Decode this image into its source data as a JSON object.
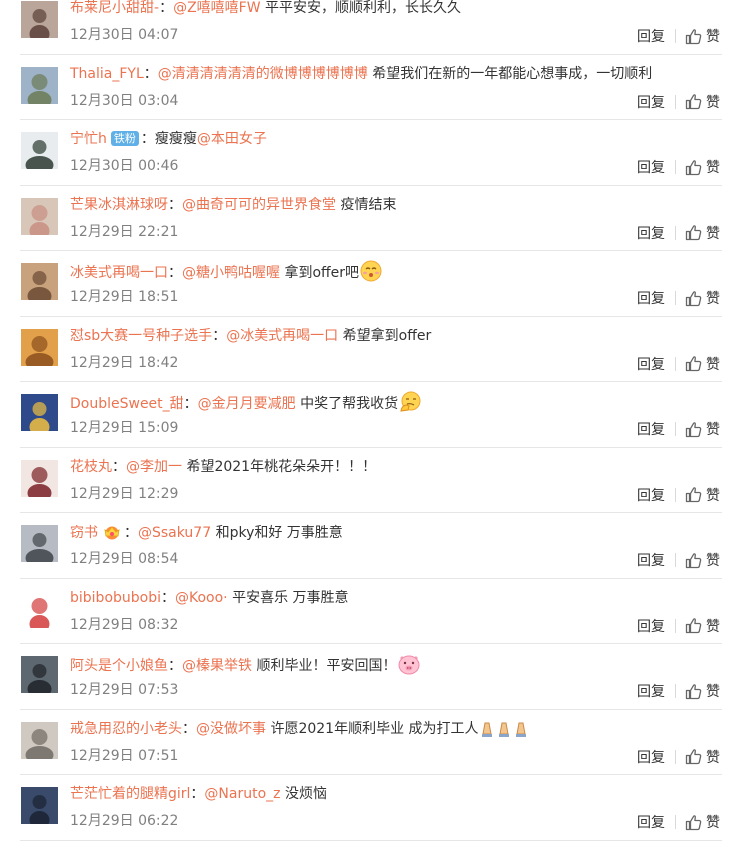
{
  "comments": [
    {
      "user": "布莱尼小甜甜-",
      "colon": "：",
      "mention": "@Z嘻嘻嘻FW",
      "text": " 平平安安，顺顺利利，长长久久",
      "time": "12月30日 04:07",
      "avatar_colors": [
        "#b9a59a",
        "#5a4038"
      ]
    },
    {
      "user": "Thalia_FYL",
      "colon": "：",
      "mention": "@清清清清清清的微博博博博博博",
      "text": " 希望我们在新的一年都能心想事成，一切顺利",
      "time": "12月30日 03:04",
      "avatar_colors": [
        "#9fb3c8",
        "#6b7a55"
      ]
    },
    {
      "user": "宁忙h",
      "badge": "铁粉",
      "colon": "：",
      "mention": "",
      "text": "瘦瘦瘦",
      "mention2": "@本田女子",
      "time": "12月30日 00:46",
      "avatar_colors": [
        "#e9ecef",
        "#2c3a30"
      ]
    },
    {
      "user": "芒果冰淇淋球呀",
      "colon": "：",
      "mention": "@曲奇可可的异世界食堂",
      "text": " 疫情结束",
      "time": "12月29日 22:21",
      "avatar_colors": [
        "#d8c7b8",
        "#c98e82"
      ]
    },
    {
      "user": "冰美式再喝一口",
      "colon": "：",
      "mention": "@糖小鸭咕喔喔",
      "text": " 拿到offer吧",
      "emoji": "smile",
      "time": "12月29日 18:51",
      "avatar_colors": [
        "#c7a27c",
        "#6b4a35"
      ]
    },
    {
      "user": "怼sb大赛一号种子选手",
      "colon": "：",
      "mention": "@冰美式再喝一口",
      "text": " 希望拿到offer",
      "time": "12月29日 18:42",
      "avatar_colors": [
        "#e3a04a",
        "#8a4f1c"
      ]
    },
    {
      "user": "DoubleSweet_甜",
      "colon": "：",
      "mention": "@金月月要减肥",
      "text": " 中奖了帮我收货",
      "emoji": "think",
      "time": "12月29日 15:09",
      "avatar_colors": [
        "#2f4a8a",
        "#f0c040"
      ]
    },
    {
      "user": "花枝丸",
      "colon": "：",
      "mention": "@李加一",
      "text": " 希望2021年桃花朵朵开！！！",
      "time": "12月29日 12:29",
      "avatar_colors": [
        "#f1e6e2",
        "#7a1f24"
      ]
    },
    {
      "user": "窃书",
      "crown": true,
      "colon": "：",
      "mention": "@Ssaku77",
      "text": " 和pky和好 万事胜意",
      "time": "12月29日 08:54",
      "avatar_colors": [
        "#b7bcc4",
        "#3e434a"
      ]
    },
    {
      "user": "bibibobubobi",
      "colon": "：",
      "mention": "@Kooo·",
      "text": " 平安喜乐 万事胜意",
      "time": "12月29日 08:32",
      "avatar_colors": [
        "#ffffff",
        "#d23a3a"
      ]
    },
    {
      "user": "阿头是个小娘鱼",
      "colon": "：",
      "mention": "@榛果举铁",
      "text": " 顺利毕业！平安回国！",
      "emoji": "pig",
      "time": "12月29日 07:53",
      "avatar_colors": [
        "#5d6770",
        "#1f2328"
      ]
    },
    {
      "user": "戒急用忍的小老头",
      "colon": "：",
      "mention": "@没做坏事",
      "text": " 许愿2021年顺利毕业 成为打工人",
      "emoji": "pray3",
      "time": "12月29日 07:51",
      "avatar_colors": [
        "#cfc9c2",
        "#6f6a63"
      ]
    },
    {
      "user": "芒茫忙着的腿精girl",
      "colon": "：",
      "mention": "@Naruto_z",
      "text": " 没烦恼",
      "time": "12月29日 06:22",
      "avatar_colors": [
        "#3a4a6a",
        "#1b2233"
      ]
    }
  ],
  "actions": {
    "reply": "回复",
    "like": "赞"
  },
  "colors": {
    "accent": "#eb7350",
    "divider": "#e6e6e6",
    "muted": "#808080",
    "text": "#333333",
    "badge": "#5fb0e6"
  }
}
